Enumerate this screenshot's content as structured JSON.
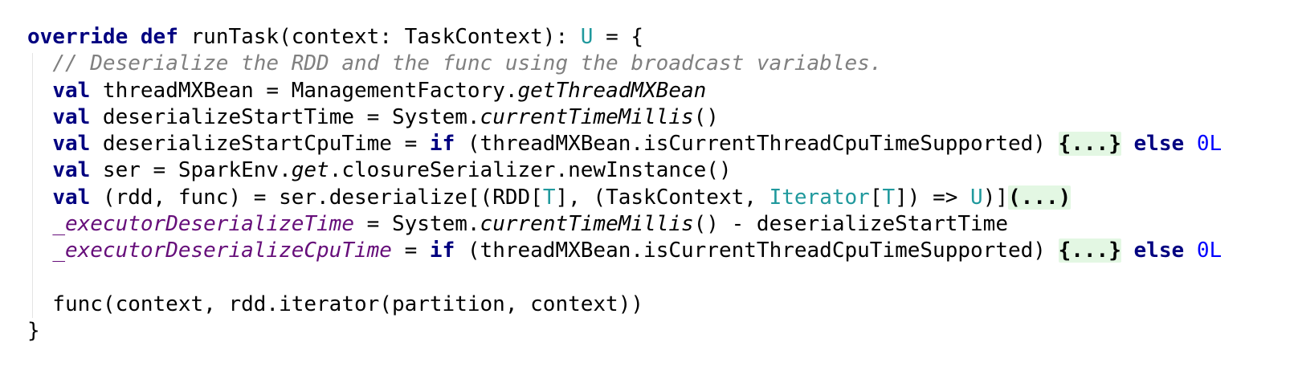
{
  "code_lines": [
    [
      {
        "t": "override",
        "c": "kw"
      },
      {
        "t": " "
      },
      {
        "t": "def",
        "c": "kw"
      },
      {
        "t": " runTask(context: TaskContext): "
      },
      {
        "t": "U",
        "c": "tp"
      },
      {
        "t": " = {"
      }
    ],
    [
      {
        "t": "  "
      },
      {
        "t": "// Deserialize the RDD and the func using the broadcast variables.",
        "c": "cm"
      }
    ],
    [
      {
        "t": "  "
      },
      {
        "t": "val",
        "c": "kw"
      },
      {
        "t": " threadMXBean = ManagementFactory."
      },
      {
        "t": "getThreadMXBean",
        "c": "it"
      }
    ],
    [
      {
        "t": "  "
      },
      {
        "t": "val",
        "c": "kw"
      },
      {
        "t": " deserializeStartTime = System."
      },
      {
        "t": "currentTimeMillis",
        "c": "it"
      },
      {
        "t": "()"
      }
    ],
    [
      {
        "t": "  "
      },
      {
        "t": "val",
        "c": "kw"
      },
      {
        "t": " deserializeStartCpuTime = "
      },
      {
        "t": "if",
        "c": "kw"
      },
      {
        "t": " (threadMXBean.isCurrentThreadCpuTimeSupported) "
      },
      {
        "t": "{...}",
        "c": "fold",
        "i": true
      },
      {
        "t": " "
      },
      {
        "t": "else",
        "c": "kw"
      },
      {
        "t": " "
      },
      {
        "t": "0L",
        "c": "num"
      }
    ],
    [
      {
        "t": "  "
      },
      {
        "t": "val",
        "c": "kw"
      },
      {
        "t": " ser = SparkEnv."
      },
      {
        "t": "get",
        "c": "it"
      },
      {
        "t": ".closureSerializer.newInstance()"
      }
    ],
    [
      {
        "t": "  "
      },
      {
        "t": "val",
        "c": "kw"
      },
      {
        "t": " (rdd, func) = ser.deserialize[(RDD["
      },
      {
        "t": "T",
        "c": "tp"
      },
      {
        "t": "], (TaskContext, "
      },
      {
        "t": "Iterator",
        "c": "tp"
      },
      {
        "t": "["
      },
      {
        "t": "T",
        "c": "tp"
      },
      {
        "t": "]) => "
      },
      {
        "t": "U",
        "c": "tp"
      },
      {
        "t": ")]"
      },
      {
        "t": "(...)",
        "c": "fold",
        "i": true
      }
    ],
    [
      {
        "t": "  "
      },
      {
        "t": "_executorDeserializeTime",
        "c": "fd"
      },
      {
        "t": " = System."
      },
      {
        "t": "currentTimeMillis",
        "c": "it"
      },
      {
        "t": "() - deserializeStartTime"
      }
    ],
    [
      {
        "t": "  "
      },
      {
        "t": "_executorDeserializeCpuTime",
        "c": "fd"
      },
      {
        "t": " = "
      },
      {
        "t": "if",
        "c": "kw"
      },
      {
        "t": " (threadMXBean.isCurrentThreadCpuTimeSupported) "
      },
      {
        "t": "{...}",
        "c": "fold",
        "i": true
      },
      {
        "t": " "
      },
      {
        "t": "else",
        "c": "kw"
      },
      {
        "t": " "
      },
      {
        "t": "0L",
        "c": "num"
      }
    ],
    [],
    [
      {
        "t": "  func(context, rdd.iterator(partition, context))"
      }
    ],
    [
      {
        "t": "}"
      }
    ]
  ]
}
